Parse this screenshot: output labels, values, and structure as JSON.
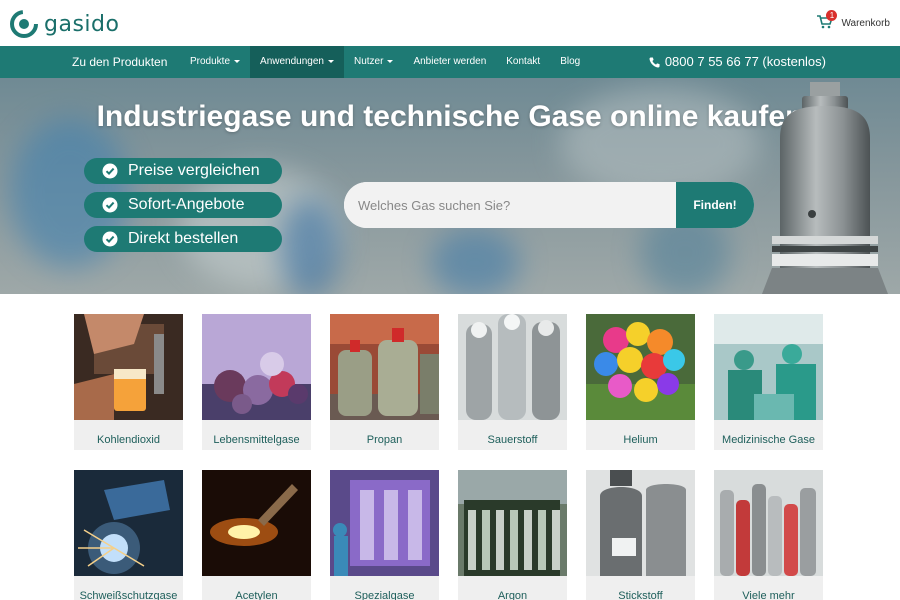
{
  "header": {
    "logo_text": "gasido",
    "cart_label": "Warenkorb",
    "cart_count": "1"
  },
  "nav": {
    "home": "Zu den Produkten",
    "items": [
      {
        "label": "Produkte",
        "dropdown": true
      },
      {
        "label": "Anwendungen",
        "dropdown": true,
        "active": true
      },
      {
        "label": "Nutzer",
        "dropdown": true
      },
      {
        "label": "Anbieter werden",
        "dropdown": false
      },
      {
        "label": "Kontakt",
        "dropdown": false
      },
      {
        "label": "Blog",
        "dropdown": false
      }
    ],
    "phone": "0800 7 55 66 77 (kostenlos)"
  },
  "hero": {
    "title": "Industriegase und technische Gase online kaufen",
    "pills": [
      "Preise vergleichen",
      "Sofort-Angebote",
      "Direkt bestellen"
    ],
    "search_placeholder": "Welches Gas suchen Sie?",
    "search_button": "Finden!"
  },
  "categories": [
    {
      "label": "Kohlendioxid"
    },
    {
      "label": "Lebensmittelgase"
    },
    {
      "label": "Propan"
    },
    {
      "label": "Sauerstoff"
    },
    {
      "label": "Helium"
    },
    {
      "label": "Medizinische Gase"
    },
    {
      "label": "Schweißschutzgase"
    },
    {
      "label": "Acetylen"
    },
    {
      "label": "Spezialgase"
    },
    {
      "label": "Argon"
    },
    {
      "label": "Stickstoff"
    },
    {
      "label": "Viele mehr"
    }
  ],
  "colors": {
    "brand": "#1e7a74",
    "brand_dark": "#155f5a",
    "badge": "#d9302c"
  },
  "icons": {
    "cart": "shopping-cart-icon",
    "phone": "phone-icon",
    "check": "check-circle-icon"
  }
}
